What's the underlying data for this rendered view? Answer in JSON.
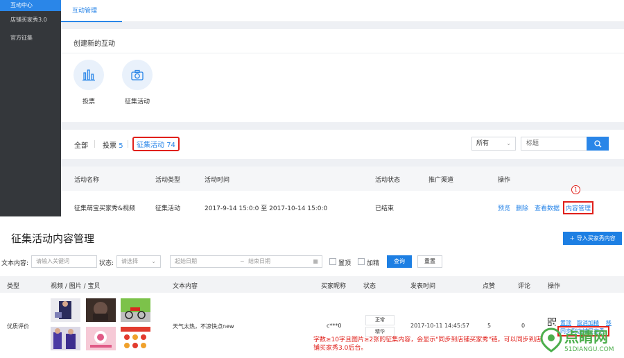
{
  "sidebar": {
    "items": [
      {
        "label": "互动中心"
      },
      {
        "label": "店铺买家秀3.0"
      },
      {
        "label": "官方征集"
      }
    ]
  },
  "tabs": {
    "active": "互动管理"
  },
  "create": {
    "title": "创建新的互动",
    "types": [
      {
        "label": "投票",
        "icon": "bar-chart-icon"
      },
      {
        "label": "征集活动",
        "icon": "camera-icon"
      }
    ]
  },
  "filter": {
    "all": "全部",
    "vote": "投票",
    "vote_count": "5",
    "collect": "征集活动",
    "collect_count": "74",
    "select_value": "所有",
    "search_placeholder": "标题"
  },
  "activity_table": {
    "headers": [
      "活动名称",
      "活动类型",
      "活动时间",
      "活动状态",
      "推广渠道",
      "操作"
    ],
    "row": {
      "name": "征集萌宝买家秀&视频",
      "type": "征集活动",
      "time": "2017-9-14 15:0:0 至 2017-10-14 15:0:0",
      "status": "已结束",
      "channel": "",
      "ops": [
        "预览",
        "删除",
        "查看数据",
        "内容管理"
      ]
    },
    "annotation_number": "1"
  },
  "content_page": {
    "title": "征集活动内容管理",
    "import_button": "导入买家秀内容",
    "filters": {
      "text_label": "文本内容:",
      "text_placeholder": "请输入关键词",
      "status_label": "状态:",
      "status_placeholder": "请选择",
      "start_placeholder": "起始日期",
      "end_placeholder": "结束日期",
      "date_sep": "~",
      "pin_label": "置顶",
      "featured_label": "加精",
      "query_button": "查询",
      "reset_button": "重置"
    },
    "headers": [
      "类型",
      "视频 / 图片 / 宝贝",
      "文本内容",
      "买家昵称",
      "状态",
      "发表时间",
      "点赞",
      "评论",
      "操作"
    ],
    "row": {
      "type": "优质评价",
      "text": "天气太热，不凉快点new",
      "nickname": "c***0",
      "status_1": "正常",
      "status_2": "精华",
      "time": "2017-10-11 14:45:57",
      "likes": "5",
      "comments": "0",
      "ops": [
        "置顶",
        "取消加精",
        "移"
      ],
      "sync_link": "同步到店铺买家秀"
    },
    "annotation": "字数≥10字且图片≥2张的征集内容，会显示\"同步到店铺买家秀\"链，可以同步到店铺买家秀3.0后台。"
  },
  "watermark": {
    "brand": "点睛网",
    "site": "51DIANGU.COM"
  }
}
